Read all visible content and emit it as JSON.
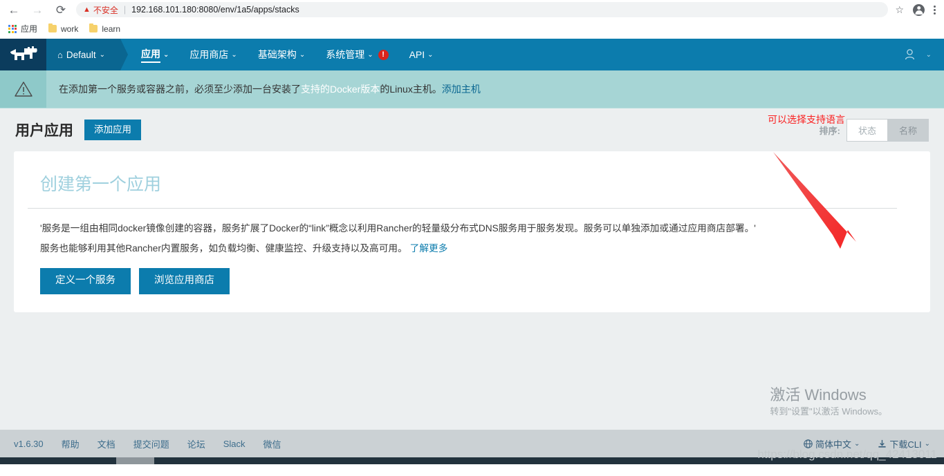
{
  "browser": {
    "back_icon": "←",
    "forward_icon": "→",
    "reload_icon": "⟳",
    "security_label": "不安全",
    "warning_icon": "▲",
    "url": "192.168.101.180:8080/env/1a5/apps/stacks",
    "star_icon": "☆",
    "profile_icon": "profile-avatar",
    "menu_icon": "kebab-menu"
  },
  "bookmarks": [
    {
      "label": "应用",
      "icon": "apps-grid-icon"
    },
    {
      "label": "work",
      "icon": "folder-icon"
    },
    {
      "label": "learn",
      "icon": "folder-icon"
    }
  ],
  "topnav": {
    "logo": "rancher-cow-logo",
    "environment": "Default",
    "home_icon": "⌂",
    "caret_icon": "⌄",
    "items": [
      {
        "label": "应用",
        "active": true,
        "badge": ""
      },
      {
        "label": "应用商店",
        "active": false,
        "badge": ""
      },
      {
        "label": "基础架构",
        "active": false,
        "badge": ""
      },
      {
        "label": "系统管理",
        "active": false,
        "badge": "!"
      },
      {
        "label": "API",
        "active": false,
        "badge": ""
      }
    ],
    "user_icon": "user-icon",
    "user_caret": "⌄"
  },
  "banner": {
    "icon": "warning-triangle-icon",
    "text_before": "在添加第一个服务或容器之前，必须至少添加一台安装了",
    "link_docker": "支持的Docker版本",
    "text_middle": " 的Linux主机。",
    "link_addhost": "添加主机"
  },
  "page": {
    "title": "用户应用",
    "add_button": "添加应用",
    "sort_label": "排序:",
    "sort_options": [
      {
        "label": "状态",
        "selected": false
      },
      {
        "label": "名称",
        "selected": true
      }
    ]
  },
  "card": {
    "title": "创建第一个应用",
    "paragraph1": "'服务是一组由相同docker镜像创建的容器，服务扩展了Docker的“link”概念以利用Rancher的轻量级分布式DNS服务用于服务发现。服务可以单独添加或通过应用商店部署。'",
    "paragraph2_text": "服务也能够利用其他Rancher内置服务，如负载均衡、健康监控、升级支持以及高可用。",
    "paragraph2_link": "了解更多",
    "buttons": [
      {
        "label": "定义一个服务"
      },
      {
        "label": "浏览应用商店"
      }
    ]
  },
  "annotation": {
    "text": "可以选择支持语言",
    "color": "#fa1f1f",
    "arrow": "red-arrow-pointing-to-language-selector"
  },
  "watermark": {
    "line1": "激活 Windows",
    "line2": "转到\"设置\"以激活 Windows。",
    "csdn": "https://blog.csdn.net/qq_42413011"
  },
  "footer": {
    "version": "v1.6.30",
    "links": [
      "帮助",
      "文档",
      "提交问题",
      "论坛",
      "Slack",
      "微信"
    ],
    "language": {
      "icon": "globe-icon",
      "label": "简体中文",
      "caret": "⌄"
    },
    "cli": {
      "icon": "download-icon",
      "label": "下载CLI",
      "caret": "⌄"
    }
  },
  "colors": {
    "rancher_blue": "#0c7cad",
    "rancher_dark": "#0b3c5d",
    "banner_teal": "#a6d5d5",
    "page_bg": "#eceff0",
    "footer_bg": "#cbd1d4",
    "annotation_red": "#fa1f1f",
    "card_title": "#9fd0de"
  }
}
